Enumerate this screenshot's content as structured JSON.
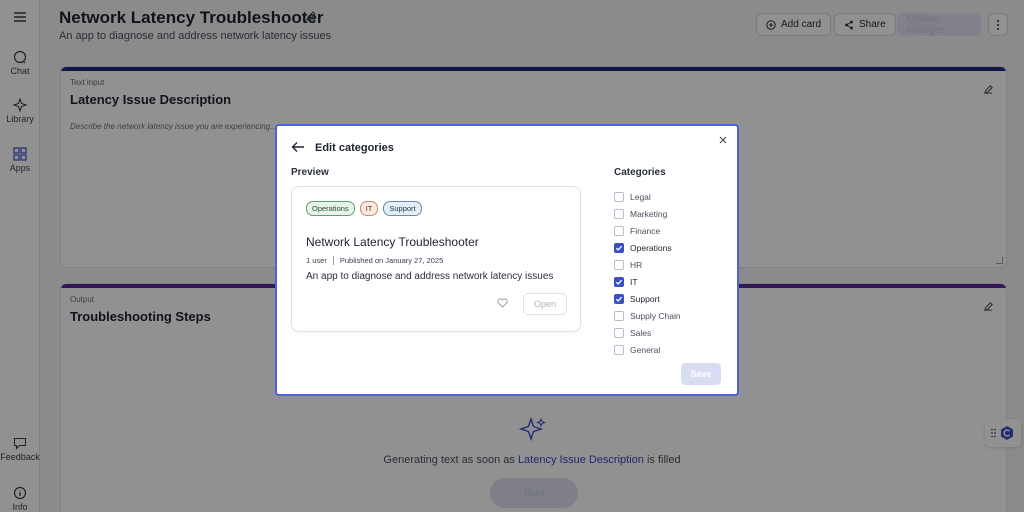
{
  "rail": {
    "items": [
      {
        "label": "Chat",
        "icon": "chat-icon"
      },
      {
        "label": "Library",
        "icon": "sparkle-icon"
      },
      {
        "label": "Apps",
        "icon": "apps-grid-icon"
      }
    ],
    "bottom": [
      {
        "label": "Feedback",
        "icon": "feedback-icon"
      },
      {
        "label": "Info",
        "icon": "info-icon"
      }
    ]
  },
  "header": {
    "title": "Network Latency Troubleshooter",
    "subtitle": "An app to diagnose and address network latency issues",
    "add_card": "Add card",
    "share": "Share",
    "publish": "Update changes"
  },
  "input_card": {
    "kind": "Text input",
    "title": "Latency Issue Description",
    "placeholder": "Describe the network latency issue you are experiencing...",
    "accent": "#1b2a7a"
  },
  "output_card": {
    "kind": "Output",
    "title": "Troubleshooting Steps",
    "generating_prefix": "Generating text as soon as",
    "generating_link": "Latency Issue Description",
    "generating_suffix": "is filled",
    "run_label": "Run",
    "accent": "#5b2a9a"
  },
  "modal": {
    "title": "Edit categories",
    "preview_label": "Preview",
    "categories_label": "Categories",
    "save_label": "Save",
    "preview": {
      "tags": [
        "Operations",
        "IT",
        "Support"
      ],
      "title": "Network Latency Troubleshooter",
      "users": "1 user",
      "published": "Published on January 27, 2025",
      "description": "An app to diagnose and address network latency issues",
      "open_label": "Open"
    },
    "categories": [
      {
        "label": "Legal",
        "checked": false
      },
      {
        "label": "Marketing",
        "checked": false
      },
      {
        "label": "Finance",
        "checked": false
      },
      {
        "label": "Operations",
        "checked": true
      },
      {
        "label": "HR",
        "checked": false
      },
      {
        "label": "IT",
        "checked": true
      },
      {
        "label": "Support",
        "checked": true
      },
      {
        "label": "Supply Chain",
        "checked": false
      },
      {
        "label": "Sales",
        "checked": false
      },
      {
        "label": "General",
        "checked": false
      }
    ]
  },
  "colors": {
    "accent": "#3b4fc8",
    "modal_border": "#4a63d8"
  }
}
